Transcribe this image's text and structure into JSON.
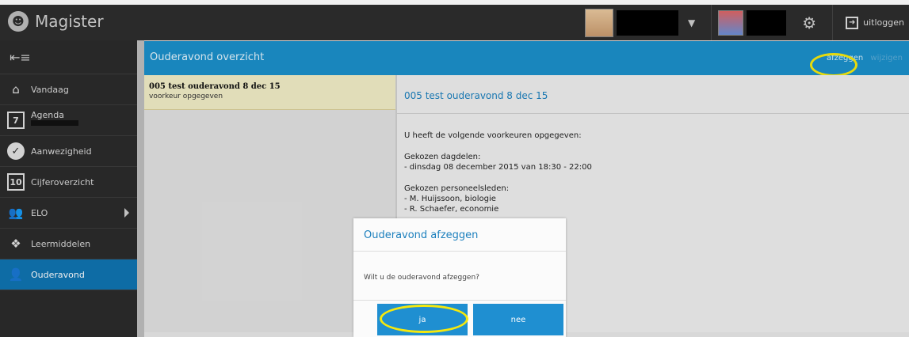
{
  "app": {
    "name": "Magister"
  },
  "topbar": {
    "logout_label": "uitloggen"
  },
  "sidebar": {
    "items": [
      {
        "label": "Vandaag"
      },
      {
        "label": "Agenda"
      },
      {
        "label": "Aanwezigheid"
      },
      {
        "label": "Cijferoverzicht",
        "icon_text": "10"
      },
      {
        "label": "ELO"
      },
      {
        "label": "Leermiddelen"
      },
      {
        "label": "Ouderavond"
      }
    ],
    "agenda_icon_text": "7"
  },
  "header": {
    "title": "Ouderavond overzicht",
    "action_afzeggen": "afzeggen",
    "action_other": "wijzigen"
  },
  "list": {
    "items": [
      {
        "title": "005 test ouderavond 8 dec 15",
        "subtitle": "voorkeur opgegeven"
      }
    ]
  },
  "detail": {
    "title": "005 test ouderavond 8 dec 15",
    "intro": "U heeft de volgende voorkeuren opgegeven:",
    "dagdelen_label": "Gekozen dagdelen:",
    "dagdelen_value": "- dinsdag 08 december 2015 van 18:30 - 22:00",
    "personeel_label": "Gekozen personeelsleden:",
    "personeel": [
      "- M. Huijssoon, biologie",
      "- R. Schaefer, economie"
    ]
  },
  "modal": {
    "title": "Ouderavond afzeggen",
    "message": "Wilt u de ouderavond afzeggen?",
    "yes_label": "ja",
    "no_label": "nee"
  },
  "colors": {
    "accent": "#1b8fc9",
    "active_nav": "#0f73b0",
    "highlight": "#f5e80e"
  }
}
